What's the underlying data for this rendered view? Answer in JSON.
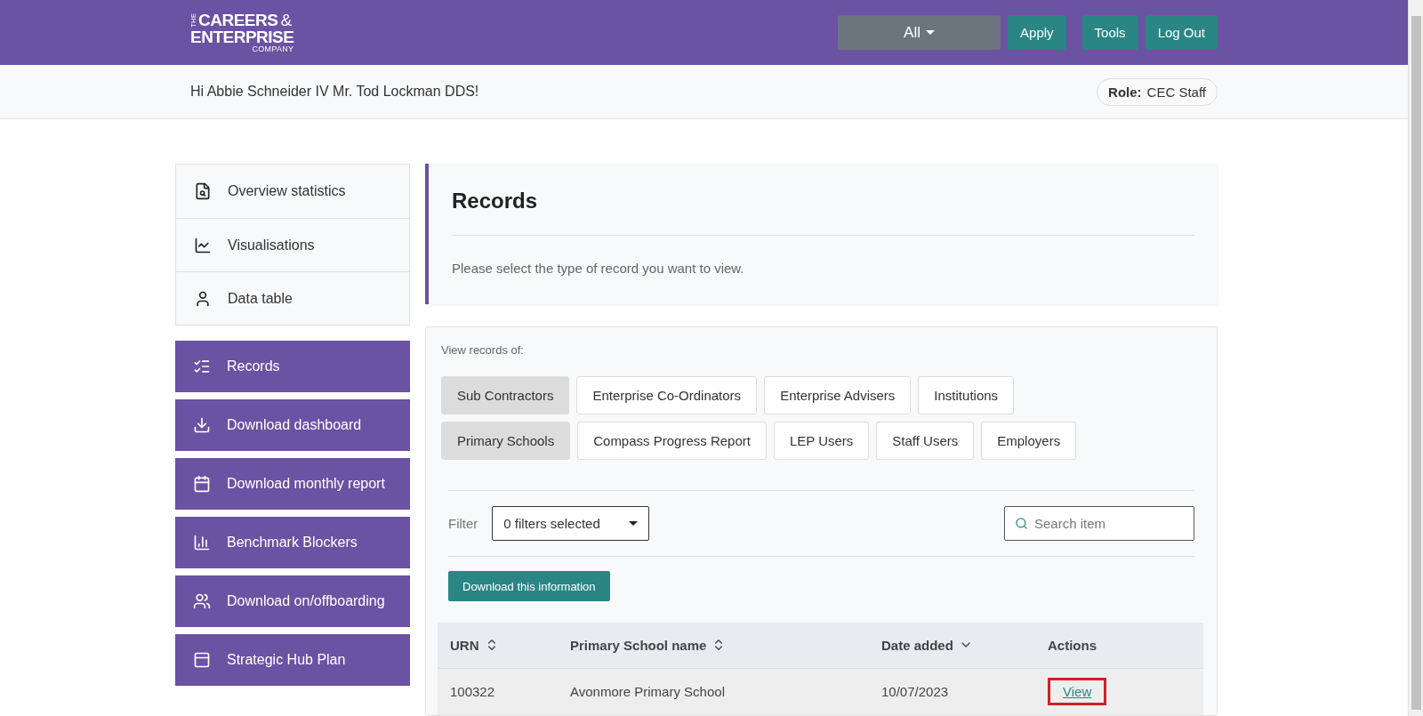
{
  "header": {
    "logo": {
      "prefix": "THE",
      "line1": "CAREERS",
      "amp": "&",
      "line2": "ENTERPRISE",
      "line3": "COMPANY"
    },
    "dropdown": "All",
    "buttons": [
      "Apply",
      "Tools",
      "Log Out"
    ]
  },
  "subheader": {
    "greeting": "Hi Abbie Schneider IV Mr. Tod Lockman DDS!",
    "role_label": "Role:",
    "role": "CEC Staff"
  },
  "sidebar": {
    "top_items": [
      {
        "label": "Overview statistics"
      },
      {
        "label": "Visualisations"
      },
      {
        "label": "Data table"
      }
    ],
    "actions": [
      {
        "label": "Records"
      },
      {
        "label": "Download dashboard"
      },
      {
        "label": "Download monthly report"
      },
      {
        "label": "Benchmark Blockers"
      },
      {
        "label": "Download on/offboarding"
      },
      {
        "label": "Strategic Hub Plan"
      }
    ]
  },
  "records_card": {
    "title": "Records",
    "text": "Please select the type of record you want to view."
  },
  "panel": {
    "label": "View records of:",
    "record_types": [
      [
        {
          "label": "Sub Contractors",
          "selected": true
        },
        {
          "label": "Enterprise Co-Ordinators",
          "selected": false
        },
        {
          "label": "Enterprise Advisers",
          "selected": false
        },
        {
          "label": "Institutions",
          "selected": false
        }
      ],
      [
        {
          "label": "Primary Schools",
          "selected": true
        },
        {
          "label": "Compass Progress Report",
          "selected": false
        },
        {
          "label": "LEP Users",
          "selected": false
        },
        {
          "label": "Staff Users",
          "selected": false
        },
        {
          "label": "Employers",
          "selected": false
        }
      ]
    ],
    "filter_label": "Filter",
    "filter_value": "0 filters selected",
    "search": {
      "placeholder": "Search item"
    },
    "download_button": "Download this information",
    "table": {
      "columns": [
        {
          "label": "URN",
          "kind": "sortable"
        },
        {
          "label": "Primary School name",
          "kind": "sortable"
        },
        {
          "label": "Date added",
          "kind": "sorted"
        },
        {
          "label": "Actions",
          "kind": "plain"
        }
      ],
      "rows": [
        {
          "cells": [
            "100322",
            "Avonmore Primary School",
            "10/07/2023"
          ],
          "action": "View",
          "highlighted": true
        }
      ]
    }
  }
}
